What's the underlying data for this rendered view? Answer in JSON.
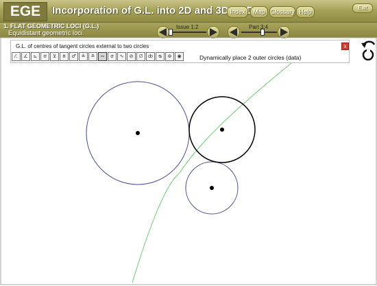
{
  "app": {
    "logo": "EGE",
    "title": "Incorporation of G.L. into 2D and 3D CAD",
    "nav": [
      "Index",
      "Map",
      "Glossary",
      "Help"
    ],
    "exit": "Exit"
  },
  "section": {
    "heading": "1. FLAT GEOMETRIC LOCI (G.L.)",
    "subheading": "Equidistant geometric loci."
  },
  "issue_slider": {
    "label": "Issue 1:2"
  },
  "part_slider": {
    "label": "Part 3:4"
  },
  "panel": {
    "title": "G.L. of centres of tangent circles external to two circles",
    "close": "x",
    "status": "Dynamically place 2 outer circles (data)",
    "tools": [
      "⁄.",
      "∠",
      "⊾",
      "ơ",
      "⊻",
      "ȣ",
      "♂",
      "≗",
      "≛",
      "∾",
      "σ",
      "∿",
      "⊘",
      "∅",
      "ȸ",
      "ᴓ",
      "⊛",
      "◉"
    ],
    "active_tool_index": 9
  },
  "colors": {
    "header_bg": "#a8a35a",
    "circle_data": "#4a4a9a",
    "circle_tangent": "#000000",
    "locus": "#6bd06b",
    "close_button": "#d23c2f"
  }
}
